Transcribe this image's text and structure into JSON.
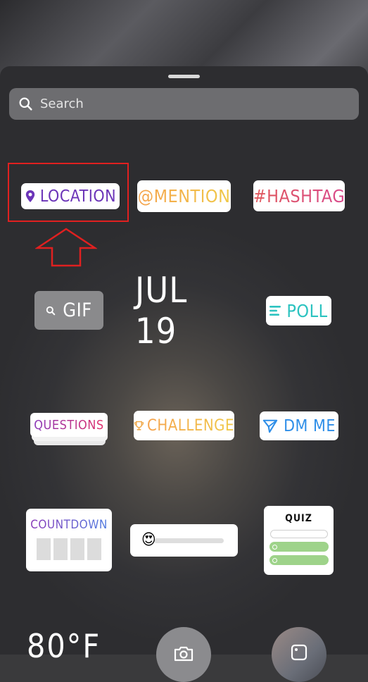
{
  "search": {
    "placeholder": "Search"
  },
  "stickers": {
    "location": "LOCATION",
    "mention": "@MENTION",
    "hashtag": "#HASHTAG",
    "gif": "GIF",
    "date": "JUL 19",
    "poll": "POLL",
    "questions": "QUESTIONS",
    "challenge": "CHALLENGE",
    "dm_me": "DM ME",
    "countdown": "COUNTDOWN",
    "quiz": "QUIZ",
    "temperature": "80°F"
  },
  "colors": {
    "location_purple": "#6b34b8",
    "highlight_red": "#e02020",
    "poll_teal": "#2cc3c0",
    "dm_blue": "#2e8ee8",
    "quiz_green": "#9ed38a"
  },
  "emoji_slider": {
    "emoji": "😍"
  }
}
